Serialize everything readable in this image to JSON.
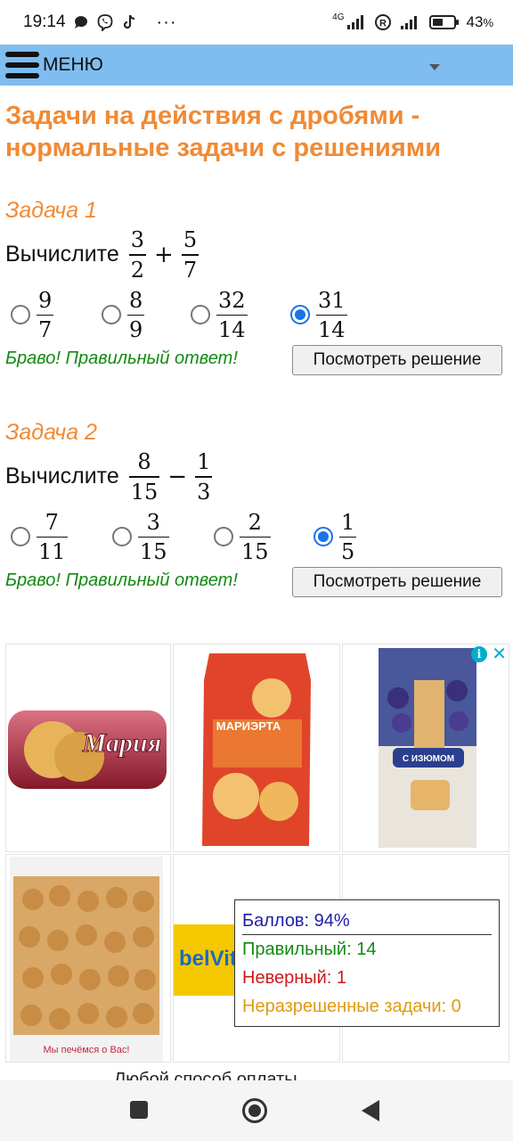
{
  "status_bar": {
    "time": "19:14",
    "network_label": "4G",
    "battery": "43",
    "battery_unit": "%",
    "icons": [
      "chat-bubble-icon",
      "viber-icon",
      "tiktok-icon",
      "more-dots-icon",
      "signal-icon",
      "roaming-icon",
      "signal-icon",
      "battery-icon"
    ]
  },
  "menu": {
    "label": "МЕНЮ"
  },
  "page_title": "Задачи на действия с дробями - нормальные задачи с решениями",
  "tasks": [
    {
      "title": "Задача 1",
      "prompt": "Вычислите",
      "expr": {
        "a_num": "3",
        "a_den": "2",
        "op": "+",
        "b_num": "5",
        "b_den": "7"
      },
      "options": [
        {
          "num": "9",
          "den": "7",
          "selected": false
        },
        {
          "num": "8",
          "den": "9",
          "selected": false
        },
        {
          "num": "32",
          "den": "14",
          "selected": false
        },
        {
          "num": "31",
          "den": "14",
          "selected": true
        }
      ],
      "feedback": "Браво! Правильный ответ!",
      "solution_button": "Посмотреть решение"
    },
    {
      "title": "Задача 2",
      "prompt": "Вычислите",
      "expr": {
        "a_num": "8",
        "a_den": "15",
        "op": "−",
        "b_num": "1",
        "b_den": "3"
      },
      "options": [
        {
          "num": "7",
          "den": "11",
          "selected": false
        },
        {
          "num": "3",
          "den": "15",
          "selected": false
        },
        {
          "num": "2",
          "den": "15",
          "selected": false
        },
        {
          "num": "1",
          "den": "5",
          "selected": true
        }
      ],
      "feedback": "Браво! Правильный ответ!",
      "solution_button": "Посмотреть решение"
    }
  ],
  "ad": {
    "products": [
      {
        "brand_text": "Мария",
        "colors": [
          "#c9253f",
          "#e7b45a"
        ]
      },
      {
        "brand_text": "МАРИЭРТА",
        "colors": [
          "#e0452a",
          "#f6b63a"
        ]
      },
      {
        "brand_text": "С ИЗЮМОМ",
        "colors": [
          "#2c3f8f",
          "#e9e4dc"
        ]
      },
      {
        "brand_text": "Мы печёмся о Вас!",
        "colors": [
          "#d9a766",
          "#f2f2f2"
        ]
      },
      {
        "brand_text": "belVita",
        "colors": [
          "#f5c800",
          "#1d6cb8"
        ]
      },
      {
        "brand_text": "",
        "colors": [
          "#ffffff",
          "#eeeeee"
        ]
      }
    ],
    "info_icon": "info-icon",
    "close_icon": "close-icon"
  },
  "score": {
    "points": "Баллов: 94%",
    "correct": "Правильный: 14",
    "wrong": "Неверный: 1",
    "unsolved": "Неразрешенные задачи: 0"
  },
  "cut_text": "Любой способ оплаты",
  "nav": {
    "icons": [
      "recent-apps-icon",
      "home-icon",
      "back-icon"
    ]
  }
}
